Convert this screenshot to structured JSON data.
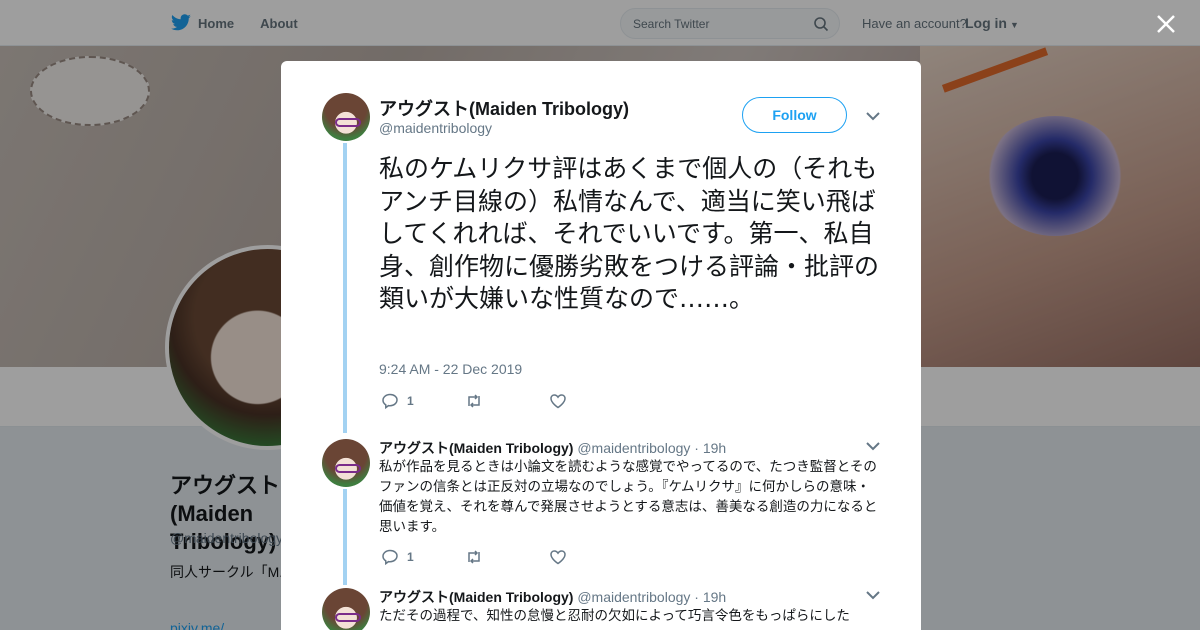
{
  "nav": {
    "home_label": "Home",
    "about_label": "About",
    "search_placeholder": "Search Twitter",
    "have_account": "Have an account?",
    "login_label": "Log in"
  },
  "profile": {
    "name": "アウグスト(Maiden Tribology)",
    "handle": "@maidentribology",
    "bio": "同人サークル「M... 用＆代表アウグス... 漫画・イラストは...",
    "link": "pixiv.me/..."
  },
  "main_tweet": {
    "name": "アウグスト(Maiden Tribology)",
    "handle": "@maidentribology",
    "follow_label": "Follow",
    "text": "私のケムリクサ評はあくまで個人の（それもアンチ目線の）私情なんで、適当に笑い飛ばしてくれれば、それでいいです。第一、私自身、創作物に優勝劣敗をつける評論・批評の類いが大嫌いな性質なので……。",
    "time": "9:24 AM - 22 Dec 2019",
    "reply_count": "1"
  },
  "replies": [
    {
      "name": "アウグスト(Maiden Tribology)",
      "handle": "@maidentribology",
      "age": "· 19h",
      "text": "私が作品を見るときは小論文を読むような感覚でやってるので、たつき監督とそのファンの信条とは正反対の立場なのでしょう。『ケムリクサ』に何かしらの意味・価値を覚え、それを尊んで発展させようとする意志は、善美なる創造の力になると思います。",
      "reply_count": "1"
    },
    {
      "name": "アウグスト(Maiden Tribology)",
      "handle": "@maidentribology",
      "age": "· 19h",
      "text": "ただその過程で、知性の怠慢と忍耐の欠如によって巧言令色をもっぱらにした"
    }
  ],
  "colors": {
    "accent": "#1da1f2",
    "thread_line": "#a3d2f2",
    "muted": "#657786"
  }
}
